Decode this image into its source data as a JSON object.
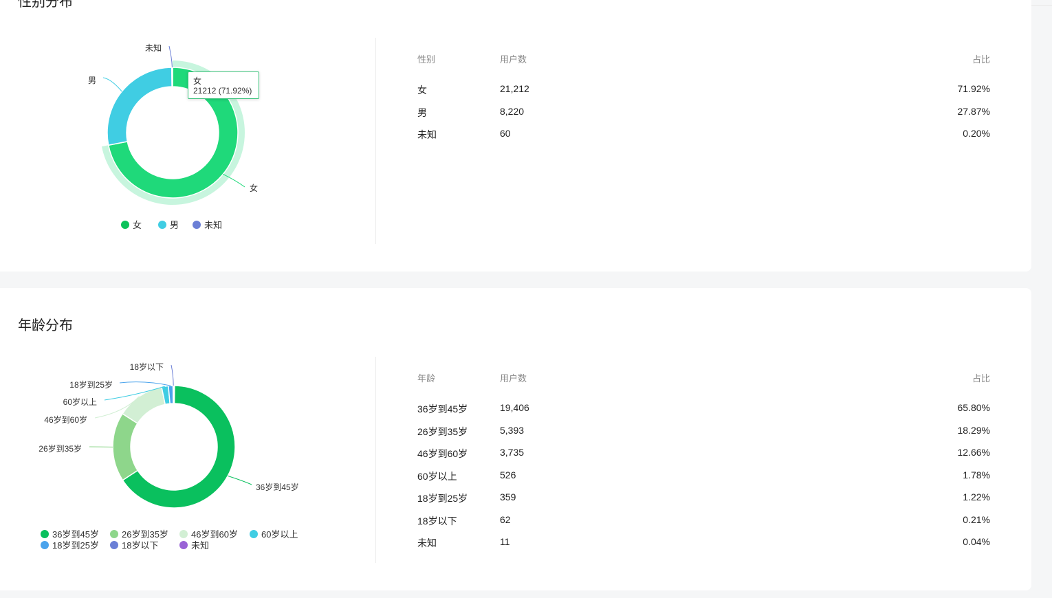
{
  "gender_section": {
    "title": "性别分布",
    "table": {
      "headers": [
        "性别",
        "用户数",
        "占比"
      ],
      "rows": [
        {
          "label": "女",
          "users": "21,212",
          "pct": "71.92%"
        },
        {
          "label": "男",
          "users": "8,220",
          "pct": "27.87%"
        },
        {
          "label": "未知",
          "users": "60",
          "pct": "0.20%"
        }
      ]
    },
    "tooltip": {
      "line1": "女",
      "line2": "21212 (71.92%)"
    }
  },
  "age_section": {
    "title": "年龄分布",
    "table": {
      "headers": [
        "年龄",
        "用户数",
        "占比"
      ],
      "rows": [
        {
          "label": "36岁到45岁",
          "users": "19,406",
          "pct": "65.80%"
        },
        {
          "label": "26岁到35岁",
          "users": "5,393",
          "pct": "18.29%"
        },
        {
          "label": "46岁到60岁",
          "users": "3,735",
          "pct": "12.66%"
        },
        {
          "label": "60岁以上",
          "users": "526",
          "pct": "1.78%"
        },
        {
          "label": "18岁到25岁",
          "users": "359",
          "pct": "1.22%"
        },
        {
          "label": "18岁以下",
          "users": "62",
          "pct": "0.21%"
        },
        {
          "label": "未知",
          "users": "11",
          "pct": "0.04%"
        }
      ]
    }
  },
  "chart_data": [
    {
      "type": "pie",
      "variant": "donut",
      "title": "性别分布",
      "categories": [
        "女",
        "男",
        "未知"
      ],
      "values": [
        21212,
        8220,
        60
      ],
      "colors": [
        "#1fd97a",
        "#40cde3",
        "#6b7fd6"
      ],
      "legend_colors": [
        "#0cc25a",
        "#40cde3",
        "#6b7fd6"
      ],
      "highlighted": "女",
      "legend": "bottom"
    },
    {
      "type": "pie",
      "variant": "donut",
      "title": "年龄分布",
      "categories": [
        "36岁到45岁",
        "26岁到35岁",
        "46岁到60岁",
        "60岁以上",
        "18岁到25岁",
        "18岁以下",
        "未知"
      ],
      "values": [
        19406,
        5393,
        3735,
        526,
        359,
        62,
        11
      ],
      "colors": [
        "#0ac05e",
        "#8ed68b",
        "#d2efd4",
        "#40cde3",
        "#4aa3ec",
        "#6b7fd6",
        "#9a63d6"
      ],
      "legend": "bottom"
    }
  ]
}
